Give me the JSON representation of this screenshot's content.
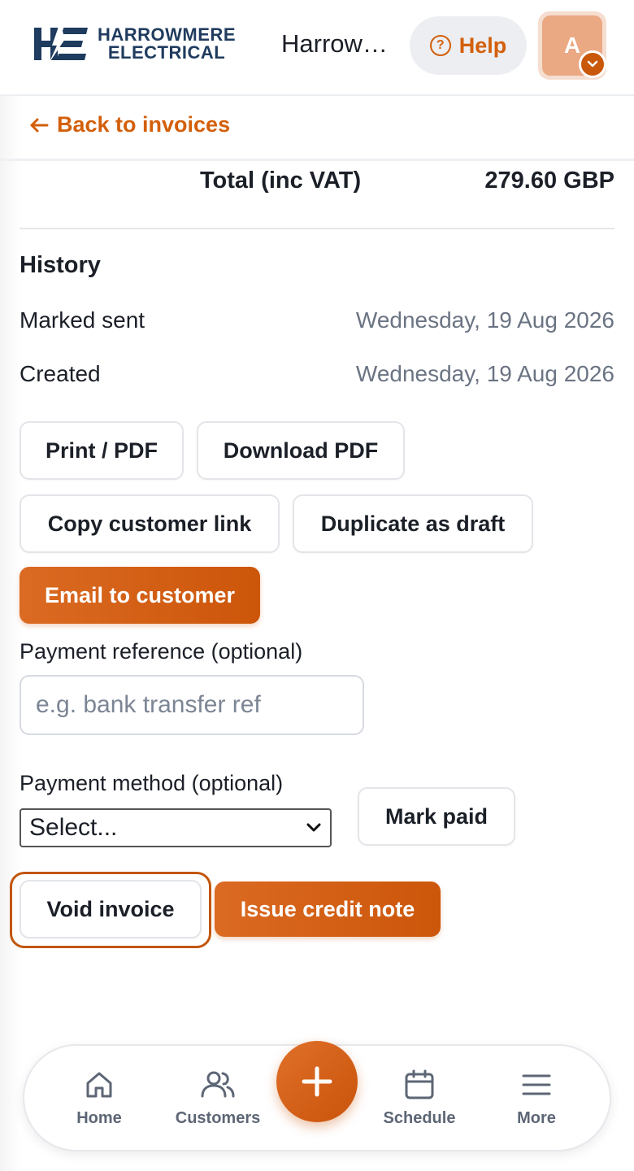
{
  "header": {
    "logo_line1": "HARROWMERE",
    "logo_line2": "ELECTRICAL",
    "org_name": "Harrowmere Electrical",
    "help_label": "Help",
    "avatar_initial": "A"
  },
  "nav": {
    "back_label": "Back to invoices"
  },
  "totals": {
    "label": "Total (inc VAT)",
    "value": "279.60 GBP"
  },
  "history": {
    "title": "History",
    "items": [
      {
        "label": "Marked sent",
        "date": "Wednesday, 19 Aug 2026"
      },
      {
        "label": "Created",
        "date": "Wednesday, 19 Aug 2026"
      }
    ]
  },
  "actions": {
    "print_pdf": "Print / PDF",
    "download_pdf": "Download PDF",
    "copy_link": "Copy customer link",
    "duplicate": "Duplicate as draft",
    "email": "Email to customer"
  },
  "payment": {
    "reference_label": "Payment reference (optional)",
    "reference_placeholder": "e.g. bank transfer ref",
    "reference_value": "",
    "method_label": "Payment method (optional)",
    "method_selected": "Select...",
    "mark_paid": "Mark paid"
  },
  "danger": {
    "void": "Void invoice",
    "credit_note": "Issue credit note"
  },
  "bottom_nav": {
    "home": "Home",
    "customers": "Customers",
    "schedule": "Schedule",
    "more": "More"
  },
  "colors": {
    "accent": "#d35f0a",
    "brand_navy": "#1f3b5e",
    "muted_text": "#6b7483"
  }
}
